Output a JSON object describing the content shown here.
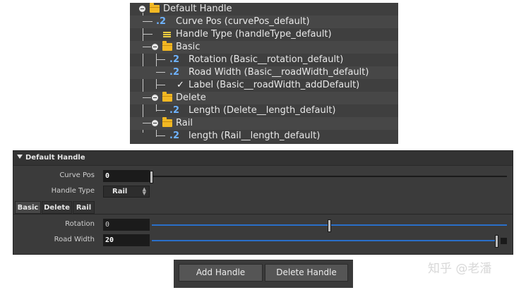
{
  "tree": {
    "items": [
      {
        "label": "Default Handle",
        "kind": "folder"
      },
      {
        "label": "Curve Pos (curvePos_default)",
        "kind": "float",
        "icon": ".2"
      },
      {
        "label": "Handle Type (handleType_default)",
        "kind": "menu"
      },
      {
        "label": "Basic",
        "kind": "folder"
      },
      {
        "label": "Rotation (Basic__rotation_default)",
        "kind": "float",
        "icon": ".2"
      },
      {
        "label": "Road Width (Basic__roadWidth_default)",
        "kind": "float",
        "icon": ".2"
      },
      {
        "label": "Label (Basic__roadWidth_addDefault)",
        "kind": "toggle",
        "icon": "✓"
      },
      {
        "label": "Delete",
        "kind": "folder"
      },
      {
        "label": "Length (Delete__length_default)",
        "kind": "float",
        "icon": ".2"
      },
      {
        "label": "Rail",
        "kind": "folder"
      },
      {
        "label": "length (Rail__length_default)",
        "kind": "float",
        "icon": ".2"
      }
    ]
  },
  "panel": {
    "title": "Default Handle",
    "curve_pos": {
      "label": "Curve Pos",
      "value": "0",
      "slider_fraction": 0.0
    },
    "handle_type": {
      "label": "Handle Type",
      "value": "Rail"
    },
    "tabs": [
      {
        "label": "Basic"
      },
      {
        "label": "Delete"
      },
      {
        "label": "Rail"
      }
    ],
    "rotation": {
      "label": "Rotation",
      "value": "0",
      "slider_fraction": 0.5
    },
    "road_width": {
      "label": "Road Width",
      "value": "20",
      "slider_fraction": 1.0
    }
  },
  "buttons": {
    "add": "Add Handle",
    "delete": "Delete Handle"
  },
  "watermark": "知乎 @老潘",
  "colors": {
    "tree_bg": "#3f3f3f",
    "folder": "#f2b823",
    "panel_bg": "#3b3b3b",
    "slider_blue": "#2a6fc9"
  }
}
